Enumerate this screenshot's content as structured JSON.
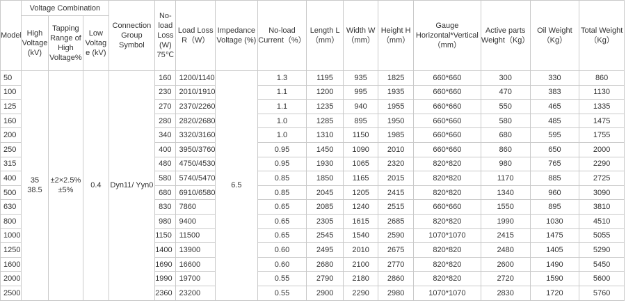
{
  "headers": {
    "model": "Model",
    "voltage_combination": "Voltage Combination",
    "high_voltage": "High Voltage (kV)",
    "tapping_range": "Tapping Range of High Voltage%",
    "low_voltage": "Low Voltage (kV)",
    "connection_group": "Connection Group Symbol",
    "noload_loss": "No-load Loss (W) 75℃",
    "load_loss": "Load Loss R（W）",
    "impedance_voltage": "Impedance Voltage (%)",
    "noload_current": "No-load Current（%）",
    "length": "Length L（mm）",
    "width": "Width W（mm）",
    "height": "Height H（mm）",
    "gauge": "Gauge Horizontal*Vertical（mm）",
    "active_parts": "Active parts Weight（Kg）",
    "oil": "Oil Weight（Kg）",
    "total": "Total Weight（Kg）"
  },
  "shared": {
    "high_voltage_line1": "35",
    "high_voltage_line2": "38.5",
    "tapping_line1": "±2×2.5%",
    "tapping_line2": "±5%",
    "low_voltage": "0.4",
    "connection_group": "Dyn11/ Yyn0",
    "impedance_voltage": "6.5"
  },
  "rows": [
    {
      "model": "50",
      "noload_loss": "160",
      "load_loss": "1200/1140",
      "noload_current": "1.3",
      "length": "1195",
      "width": "935",
      "height": "1825",
      "gauge": "660*660",
      "active": "300",
      "oil": "330",
      "total": "860"
    },
    {
      "model": "100",
      "noload_loss": "230",
      "load_loss": "2010/1910",
      "noload_current": "1.1",
      "length": "1200",
      "width": "995",
      "height": "1935",
      "gauge": "660*660",
      "active": "470",
      "oil": "383",
      "total": "1130"
    },
    {
      "model": "125",
      "noload_loss": "270",
      "load_loss": "2370/2260",
      "noload_current": "1.1",
      "length": "1235",
      "width": "940",
      "height": "1955",
      "gauge": "660*660",
      "active": "550",
      "oil": "465",
      "total": "1335"
    },
    {
      "model": "160",
      "noload_loss": "280",
      "load_loss": "2820/2680",
      "noload_current": "1.0",
      "length": "1285",
      "width": "895",
      "height": "1950",
      "gauge": "660*660",
      "active": "580",
      "oil": "485",
      "total": "1475"
    },
    {
      "model": "200",
      "noload_loss": "340",
      "load_loss": "3320/3160",
      "noload_current": "1.0",
      "length": "1310",
      "width": "1150",
      "height": "1985",
      "gauge": "660*660",
      "active": "680",
      "oil": "595",
      "total": "1755"
    },
    {
      "model": "250",
      "noload_loss": "400",
      "load_loss": "3950/3760",
      "noload_current": "0.95",
      "length": "1450",
      "width": "1090",
      "height": "2010",
      "gauge": "660*660",
      "active": "860",
      "oil": "650",
      "total": "2000"
    },
    {
      "model": "315",
      "noload_loss": "480",
      "load_loss": "4750/4530",
      "noload_current": "0.95",
      "length": "1930",
      "width": "1065",
      "height": "2320",
      "gauge": "820*820",
      "active": "980",
      "oil": "765",
      "total": "2290"
    },
    {
      "model": "400",
      "noload_loss": "580",
      "load_loss": "5740/5470",
      "noload_current": "0.85",
      "length": "1850",
      "width": "1165",
      "height": "2015",
      "gauge": "820*820",
      "active": "1170",
      "oil": "885",
      "total": "2725"
    },
    {
      "model": "500",
      "noload_loss": "680",
      "load_loss": "6910/6580",
      "noload_current": "0.85",
      "length": "2045",
      "width": "1205",
      "height": "2415",
      "gauge": "820*820",
      "active": "1340",
      "oil": "960",
      "total": "3090"
    },
    {
      "model": "630",
      "noload_loss": "830",
      "load_loss": "7860",
      "noload_current": "0.65",
      "length": "2085",
      "width": "1240",
      "height": "2515",
      "gauge": "660*660",
      "active": "1550",
      "oil": "895",
      "total": "3810"
    },
    {
      "model": "800",
      "noload_loss": "980",
      "load_loss": "9400",
      "noload_current": "0.65",
      "length": "2305",
      "width": "1615",
      "height": "2685",
      "gauge": "820*820",
      "active": "1990",
      "oil": "1030",
      "total": "4510"
    },
    {
      "model": "1000",
      "noload_loss": "1150",
      "load_loss": "11500",
      "noload_current": "0.65",
      "length": "2545",
      "width": "1540",
      "height": "2590",
      "gauge": "1070*1070",
      "active": "2415",
      "oil": "1475",
      "total": "5055"
    },
    {
      "model": "1250",
      "noload_loss": "1400",
      "load_loss": "13900",
      "noload_current": "0.60",
      "length": "2495",
      "width": "2010",
      "height": "2675",
      "gauge": "820*820",
      "active": "2480",
      "oil": "1405",
      "total": "5290"
    },
    {
      "model": "1600",
      "noload_loss": "1690",
      "load_loss": "16600",
      "noload_current": "0.60",
      "length": "2680",
      "width": "2100",
      "height": "2770",
      "gauge": "820*820",
      "active": "2600",
      "oil": "1490",
      "total": "5450"
    },
    {
      "model": "2000",
      "noload_loss": "1990",
      "load_loss": "19700",
      "noload_current": "0.55",
      "length": "2790",
      "width": "2180",
      "height": "2860",
      "gauge": "820*820",
      "active": "2720",
      "oil": "1590",
      "total": "5600"
    },
    {
      "model": "2500",
      "noload_loss": "2360",
      "load_loss": "23200",
      "noload_current": "0.55",
      "length": "2900",
      "width": "2290",
      "height": "2980",
      "gauge": "1070*1070",
      "active": "2830",
      "oil": "1720",
      "total": "5760"
    }
  ]
}
